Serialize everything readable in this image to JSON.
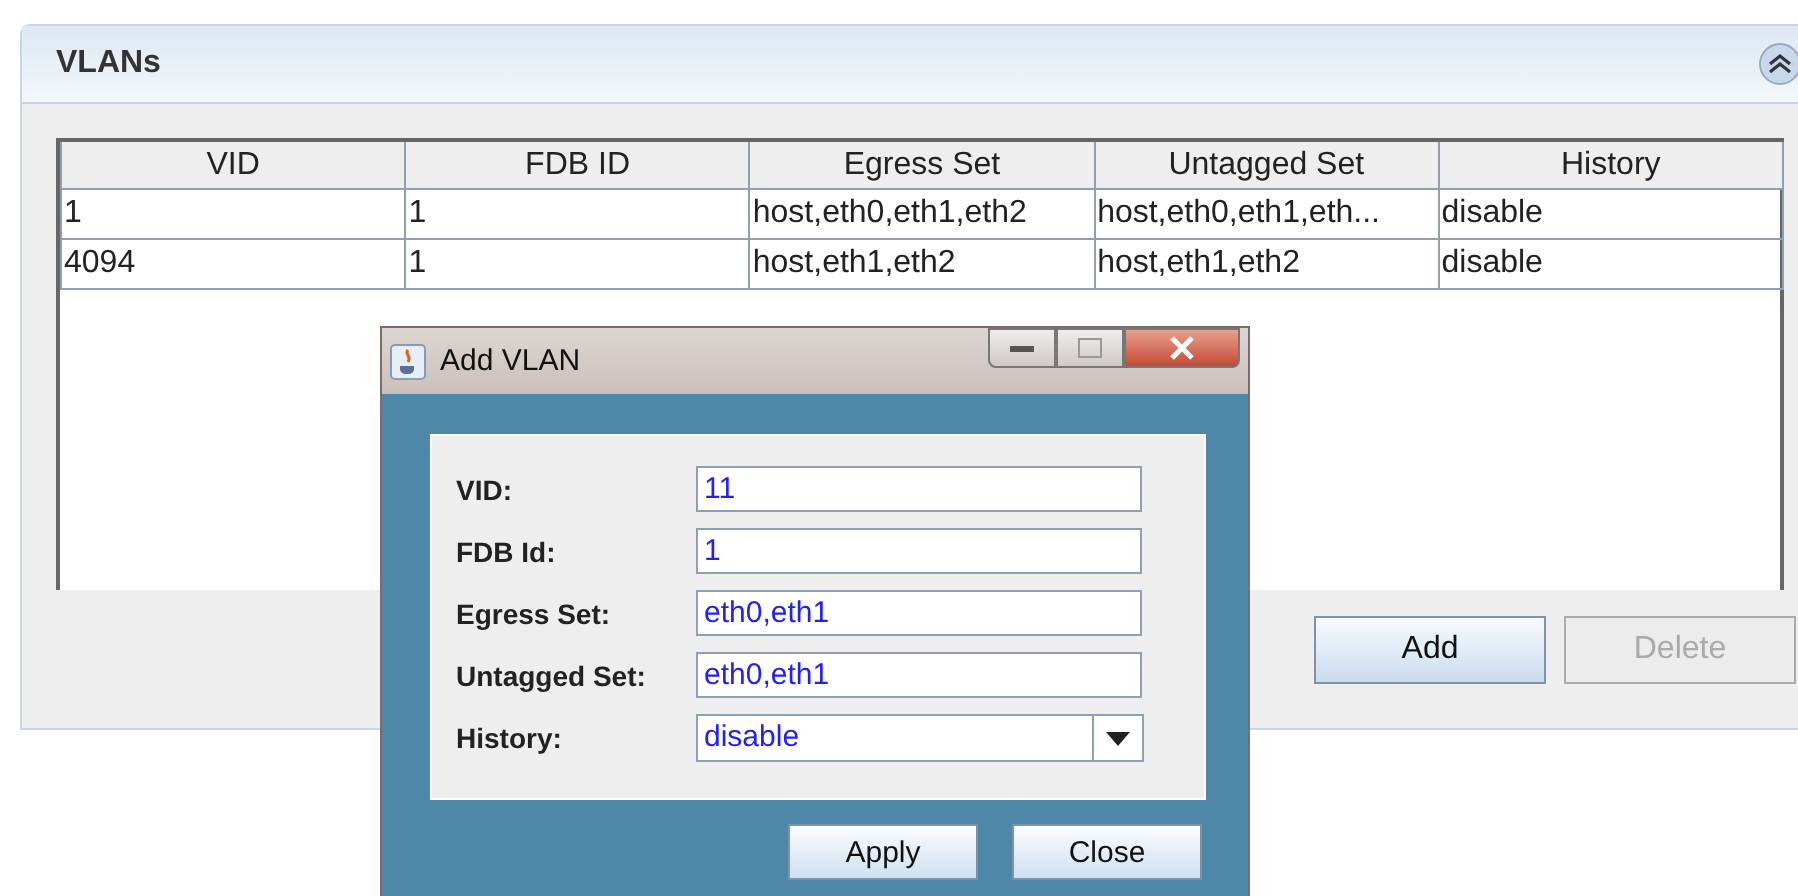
{
  "panel": {
    "title": "VLANs"
  },
  "table": {
    "columns": [
      "VID",
      "FDB ID",
      "Egress Set",
      "Untagged Set",
      "History"
    ],
    "rows": [
      [
        "1",
        "1",
        "host,eth0,eth1,eth2",
        "host,eth0,eth1,eth...",
        "disable"
      ],
      [
        "4094",
        "1",
        "host,eth1,eth2",
        "host,eth1,eth2",
        "disable"
      ]
    ]
  },
  "buttons": [
    {
      "label": "Add",
      "disabled": false
    },
    {
      "label": "Delete",
      "disabled": true
    }
  ],
  "dialog": {
    "title": "Add VLAN",
    "fields": [
      {
        "label": "VID:",
        "kind": "text",
        "value": "11"
      },
      {
        "label": "FDB Id:",
        "kind": "text",
        "value": "1"
      },
      {
        "label": "Egress Set:",
        "kind": "text",
        "value": "eth0,eth1"
      },
      {
        "label": "Untagged Set:",
        "kind": "text",
        "value": "eth0,eth1"
      },
      {
        "label": "History:",
        "kind": "select",
        "value": "disable"
      }
    ],
    "buttons": [
      "Apply",
      "Close"
    ]
  }
}
